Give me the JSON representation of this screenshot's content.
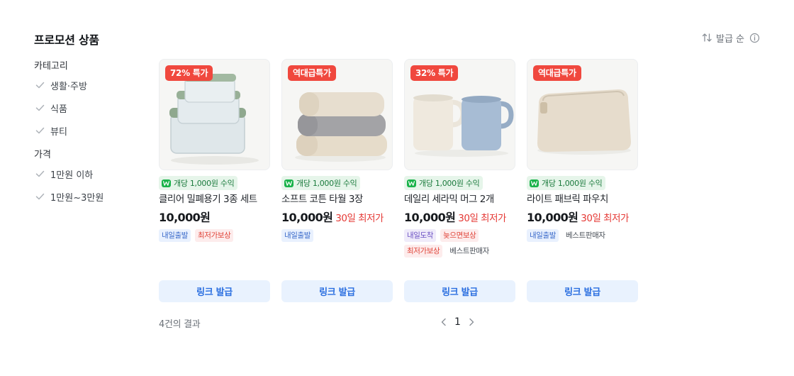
{
  "page": {
    "title": "프로모션 상품"
  },
  "sort": {
    "label": "발급 순"
  },
  "filters": [
    {
      "title": "카테고리",
      "items": [
        "생활·주방",
        "식품",
        "뷰티"
      ]
    },
    {
      "title": "가격",
      "items": [
        "1만원 이하",
        "1만원~3만원"
      ]
    }
  ],
  "products": [
    {
      "badge": "72% 특가",
      "earn": "개당 1,000원 수익",
      "name": "클리어 밀폐용기 3종 세트",
      "price": "10,000원",
      "price_note": "",
      "tags": [
        {
          "text": "내일출발",
          "style": "blue"
        },
        {
          "text": "최저가보상",
          "style": "red"
        }
      ],
      "button": "링크 발급"
    },
    {
      "badge": "역대급특가",
      "earn": "개당 1,000원 수익",
      "name": "소프트 코튼 타월 3장",
      "price": "10,000원",
      "price_note": "30일 최저가",
      "tags": [
        {
          "text": "내일출발",
          "style": "blue"
        }
      ],
      "button": "링크 발급"
    },
    {
      "badge": "32% 특가",
      "earn": "개당 1,000원 수익",
      "name": "데일리 세라믹 머그 2개",
      "price": "10,000원",
      "price_note": "30일 최저가",
      "tags": [
        {
          "text": "내일도착",
          "style": "purple"
        },
        {
          "text": "늦으면보상",
          "style": "red"
        },
        {
          "text": "최저가보상",
          "style": "red"
        },
        {
          "text": "베스트판매자",
          "style": "plain"
        }
      ],
      "button": "링크 발급"
    },
    {
      "badge": "역대급특가",
      "earn": "개당 1,000원 수익",
      "name": "라이트 패브릭 파우치",
      "price": "10,000원",
      "price_note": "30일 최저가",
      "tags": [
        {
          "text": "내일출발",
          "style": "blue"
        },
        {
          "text": "베스트판매자",
          "style": "plain"
        }
      ],
      "button": "링크 발급"
    }
  ],
  "results": {
    "count_text": "4건의 결과"
  },
  "pagination": {
    "current": "1"
  },
  "icons": {
    "sort": "sort-arrows-icon",
    "info": "info-icon",
    "check": "check-icon",
    "earn": "won-coin-icon",
    "prev": "chevron-left-icon",
    "next": "chevron-right-icon"
  },
  "colors": {
    "badge": "#f0483e",
    "button_bg": "#e9f2fe",
    "button_text": "#2b6fe0",
    "price_note": "#e53935",
    "earn_bg": "#e6f5ea",
    "earn_text": "#1a7a3c"
  }
}
